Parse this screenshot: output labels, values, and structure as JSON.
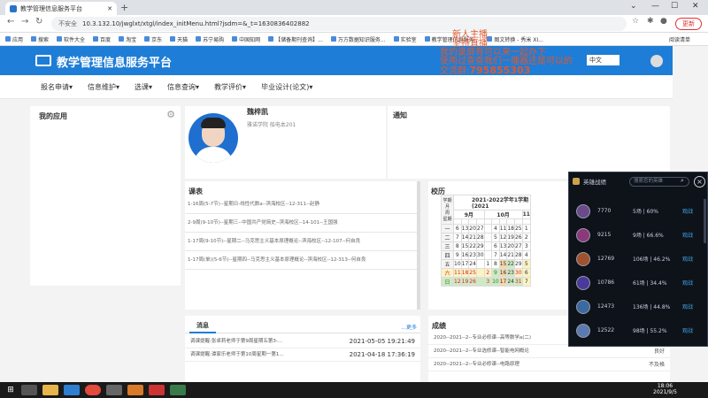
{
  "browser": {
    "tab_title": "教学管理信息服务平台",
    "url_warning": "不安全",
    "url": "10.3.132.10/jwglxt/xtgl/index_initMenu.html?jsdm=&_t=1630836402882",
    "update_label": "更新",
    "bookmarks": [
      "应用",
      "搜索",
      "软件大全",
      "百度",
      "淘宝",
      "京东",
      "天猫",
      "苏宁易购",
      "中国知网",
      "【储备期刊查询】...",
      "万方数据知识服务...",
      "实验室",
      "教学管理信息服务...",
      "图文转换 - 秀米 XI..."
    ],
    "reading_list": "阅读清单"
  },
  "app": {
    "title": "教学管理信息服务平台",
    "lang": "中文",
    "menu": [
      "报名申请▾",
      "信息维护▾",
      "选课▾",
      "信息查询▾",
      "教学评价▾",
      "毕业设计(论文)▾"
    ]
  },
  "my_apps": {
    "title": "我的应用"
  },
  "profile": {
    "name": "魏梓凯",
    "info": "雅诺学院 船电本201"
  },
  "notice": {
    "title": "通知"
  },
  "course": {
    "title": "课表",
    "lines": [
      "1-16周(5-7节)--星期日-线性代数a--滨海校区--12-311--赵静",
      "2-9周(9-10节)--星期三--中国共产党简史--滨海校区--14-101--王国强",
      "1-17周(9-10节)--星期二--马克思主义基本原理概论--滨海校区--12-107--何自良",
      "1-17周(单)(5-6节)--星期四--马克思主义基本原理概论--滨海校区--12-313--何自良"
    ]
  },
  "calendar": {
    "title": "校历",
    "header": "2021-2022学年1学期(2021",
    "corner": [
      "学期",
      "月",
      "周",
      "星期"
    ],
    "months": [
      "9月",
      "10月",
      "11"
    ],
    "weekdays": [
      "一",
      "二",
      "三",
      "四",
      "五",
      "六",
      "日"
    ],
    "rows": [
      [
        "6",
        "13",
        "20",
        "27",
        "",
        "4",
        "11",
        "18",
        "25",
        "1"
      ],
      [
        "7",
        "14",
        "21",
        "28",
        "",
        "5",
        "12",
        "19",
        "26",
        "2"
      ],
      [
        "8",
        "15",
        "22",
        "29",
        "",
        "6",
        "13",
        "20",
        "27",
        "3"
      ],
      [
        "9",
        "16",
        "23",
        "30",
        "",
        "7",
        "14",
        "21",
        "28",
        "4"
      ],
      [
        "10",
        "17",
        "24",
        "",
        "1",
        "8",
        "15",
        "22",
        "29",
        "5"
      ],
      [
        "11",
        "18",
        "25",
        "",
        "2",
        "9",
        "16",
        "23",
        "30",
        "6"
      ],
      [
        "12",
        "19",
        "26",
        "",
        "3",
        "10",
        "17",
        "24",
        "31",
        "7"
      ]
    ]
  },
  "messages": {
    "tab": "消息",
    "more": "更多",
    "items": [
      {
        "text": "调课提醒:张卓莉老师于第9周星期五第3-...",
        "time": "2021-05-05 19:21:49"
      },
      {
        "text": "调课提醒:谭家乐老师于第10周星期一第1...",
        "time": "2021-04-18 17:36:19"
      }
    ]
  },
  "grades": {
    "title": "成绩",
    "items": [
      {
        "course": "2020--2021--2--专业必修课--高等数学a(二)",
        "score": ""
      },
      {
        "course": "2020--2021--2--专业选修课--智能电网概论",
        "score": "良好"
      },
      {
        "course": "2020--2021--2--专业必修课--电路原理",
        "score": "不及格"
      }
    ]
  },
  "overlay": {
    "lines": [
      "新人主播",
      "坚持直播",
      "我的录屏有可以来一起办下",
      "使用过查查我们一播器还是可以的",
      "交流群:"
    ],
    "qq": "795855303"
  },
  "game": {
    "title": "英雄战绩",
    "search_placeholder": "搜索您的英雄",
    "close": "×",
    "players": [
      {
        "points": "7770",
        "record": "5场 | 60%",
        "action": "观战",
        "color": "#6a4a8a"
      },
      {
        "points": "9215",
        "record": "9场 | 66.6%",
        "action": "观战",
        "color": "#8a3a7a"
      },
      {
        "points": "12769",
        "record": "106场 | 46.2%",
        "action": "观战",
        "color": "#a0522d"
      },
      {
        "points": "10786",
        "record": "61场 | 34.4%",
        "action": "观战",
        "color": "#4a3a9a"
      },
      {
        "points": "12473",
        "record": "136场 | 44.8%",
        "action": "观战",
        "color": "#3a6aa0"
      },
      {
        "points": "12522",
        "record": "98场 | 55.2%",
        "action": "观战",
        "color": "#5a7ab0"
      }
    ]
  },
  "taskbar": {
    "time": "18:06",
    "date": "2021/9/5"
  }
}
